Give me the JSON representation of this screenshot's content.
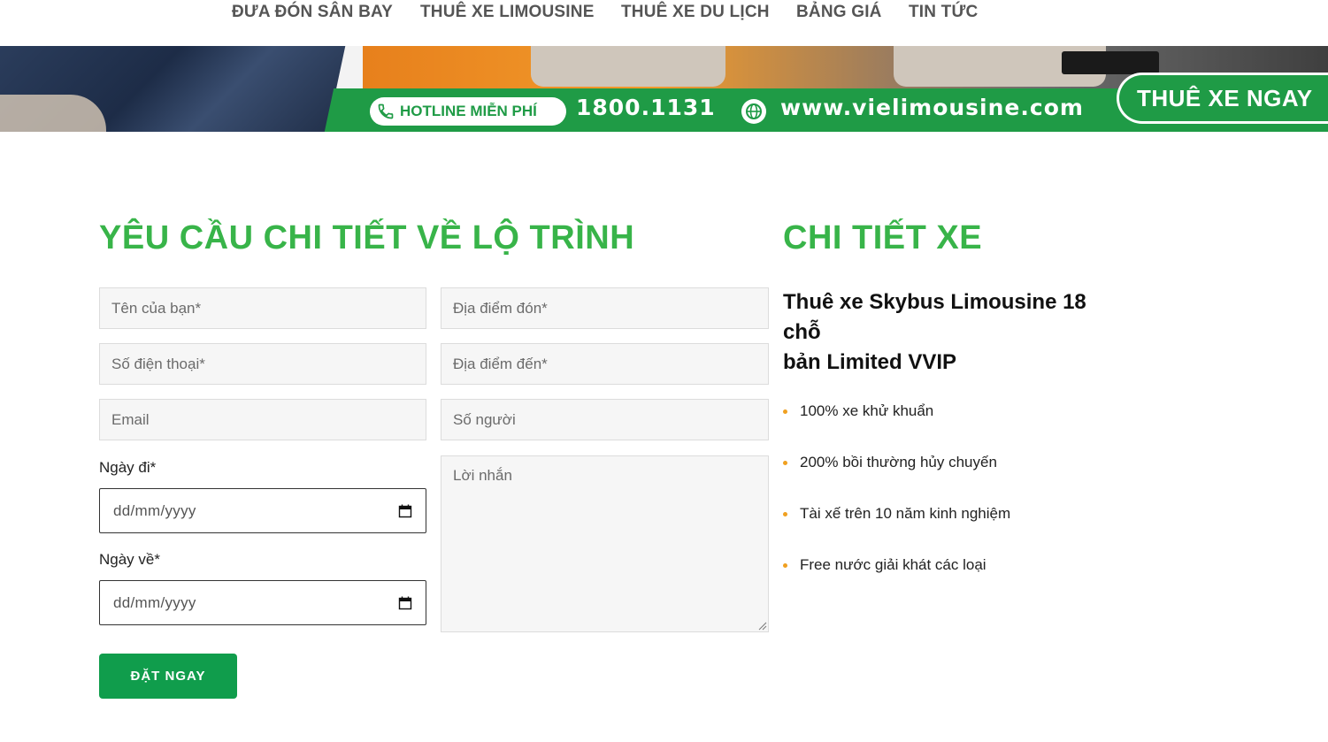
{
  "nav": {
    "items": [
      {
        "label": "ĐƯA ĐÓN SÂN BAY"
      },
      {
        "label": "THUÊ XE LIMOUSINE"
      },
      {
        "label": "THUÊ XE DU LỊCH"
      },
      {
        "label": "BẢNG GIÁ"
      },
      {
        "label": "TIN TỨC"
      }
    ]
  },
  "banner": {
    "hotline_label": "HOTLINE MIỄN PHÍ",
    "hotline_number": "1800.1131",
    "website": "www.vielimousine.com",
    "cta_label": "THUÊ XE NGAY",
    "phone_icon": "phone-icon",
    "globe_icon": "globe-icon"
  },
  "form": {
    "title": "YÊU CẦU CHI TIẾT VỀ LỘ TRÌNH",
    "name_placeholder": "Tên của bạn*",
    "phone_placeholder": "Số điện thoại*",
    "email_placeholder": "Email",
    "pickup_placeholder": "Địa điểm đón*",
    "dropoff_placeholder": "Địa điểm đến*",
    "people_placeholder": "Số người",
    "message_placeholder": "Lời nhắn",
    "depart_label": "Ngày đi*",
    "return_label": "Ngày về*",
    "date_placeholder": "dd/mm/yyyy",
    "submit_label": "ĐẶT NGAY"
  },
  "vehicle": {
    "title": "CHI TIẾT XE",
    "name_line1": "Thuê xe Skybus Limousine 18 chỗ",
    "name_line2": "bản Limited VVIP",
    "features": [
      "100% xe khử khuẩn",
      "200% bồi thường hủy chuyến",
      "Tài xế trên 10 năm kinh nghiệm",
      "Free nước giải khát các loại"
    ]
  },
  "colors": {
    "brand_green": "#38b449",
    "button_green": "#109d4c",
    "banner_green": "#1f9b46",
    "bullet_orange": "#f0a020"
  }
}
